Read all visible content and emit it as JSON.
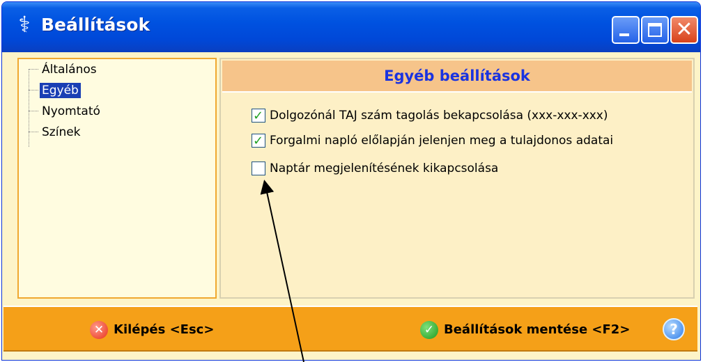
{
  "window": {
    "title": "Beállítások",
    "title_icon": "caduceus-icon",
    "controls": {
      "minimize": "minimize",
      "maximize": "maximize",
      "close": "close"
    }
  },
  "tree": {
    "items": [
      {
        "label": "Általános",
        "selected": false
      },
      {
        "label": "Egyéb",
        "selected": true
      },
      {
        "label": "Nyomtató",
        "selected": false
      },
      {
        "label": "Színek",
        "selected": false
      }
    ]
  },
  "panel": {
    "title": "Egyéb beállítások",
    "title_color": "#1a33e0",
    "options": [
      {
        "label": "Dolgozónál TAJ szám tagolás bekapcsolása (xxx-xxx-xxx)",
        "checked": true
      },
      {
        "label": "Forgalmi napló előlapján jelenjen meg a tulajdonos adatai",
        "checked": true
      },
      {
        "label": "Naptár megjelenítésének kikapcsolása",
        "checked": false
      }
    ]
  },
  "footer": {
    "exit_label": "Kilépés <Esc>",
    "save_label": "Beállítások mentése <F2>",
    "help_glyph": "?",
    "bg_color": "#f5a018"
  }
}
